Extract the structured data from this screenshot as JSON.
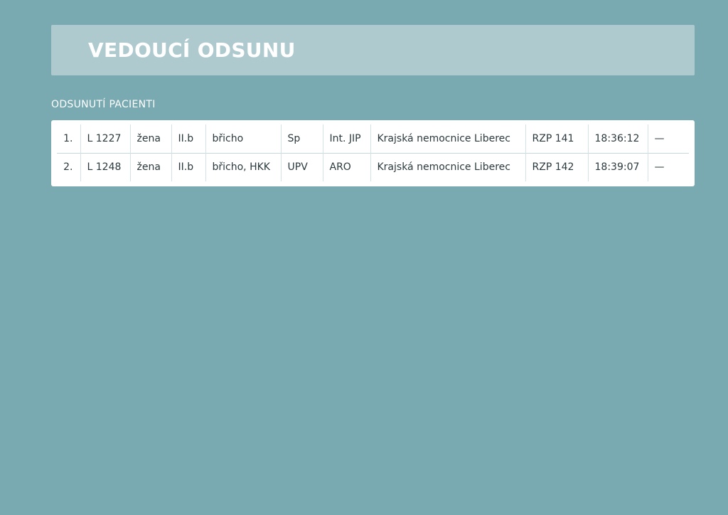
{
  "header": {
    "title": "VEDOUCÍ ODSUNU"
  },
  "section": {
    "label": "ODSUNUTÍ PACIENTI"
  },
  "patients": [
    {
      "index": "1.",
      "id": "L 1227",
      "sex": "žena",
      "triage": "II.b",
      "injury": "břicho",
      "category": "Sp",
      "destination_unit": "Int. JIP",
      "hospital": "Krajská nemocnice Liberec",
      "vehicle": "RZP 141",
      "time": "18:36:12",
      "note": "—"
    },
    {
      "index": "2.",
      "id": "L 1248",
      "sex": "žena",
      "triage": "II.b",
      "injury": "břicho, HKK",
      "category": "UPV",
      "destination_unit": "ARO",
      "hospital": "Krajská nemocnice Liberec",
      "vehicle": "RZP 142",
      "time": "18:39:07",
      "note": "—"
    }
  ],
  "colors": {
    "background": "#79aab1",
    "banner": "#aecacf",
    "card": "#ffffff",
    "text": "#2b3a3e"
  }
}
